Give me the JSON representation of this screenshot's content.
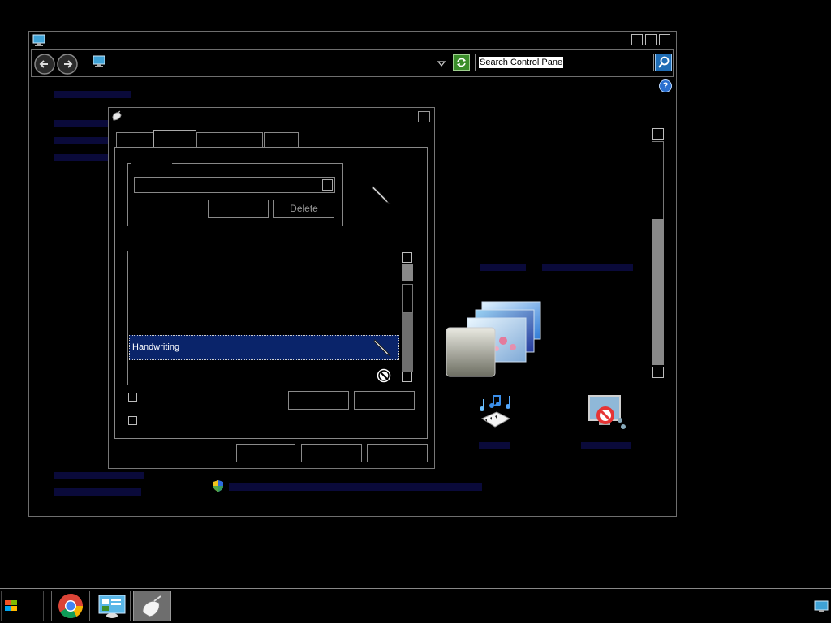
{
  "control_panel": {
    "search_placeholder": "Search Control Panel",
    "help_glyph": "?"
  },
  "pointer_dialog": {
    "scheme": {
      "delete_label": "Delete"
    },
    "cursor_list": {
      "items": [
        {
          "label": "Handwriting",
          "selected": true
        }
      ]
    }
  },
  "taskbar": {
    "apps": [
      {
        "name": "chrome"
      },
      {
        "name": "control-panel"
      },
      {
        "name": "mouse-properties",
        "active": true
      }
    ]
  },
  "colors": {
    "selection": "#0a246a",
    "link": "#1a1aa8"
  }
}
